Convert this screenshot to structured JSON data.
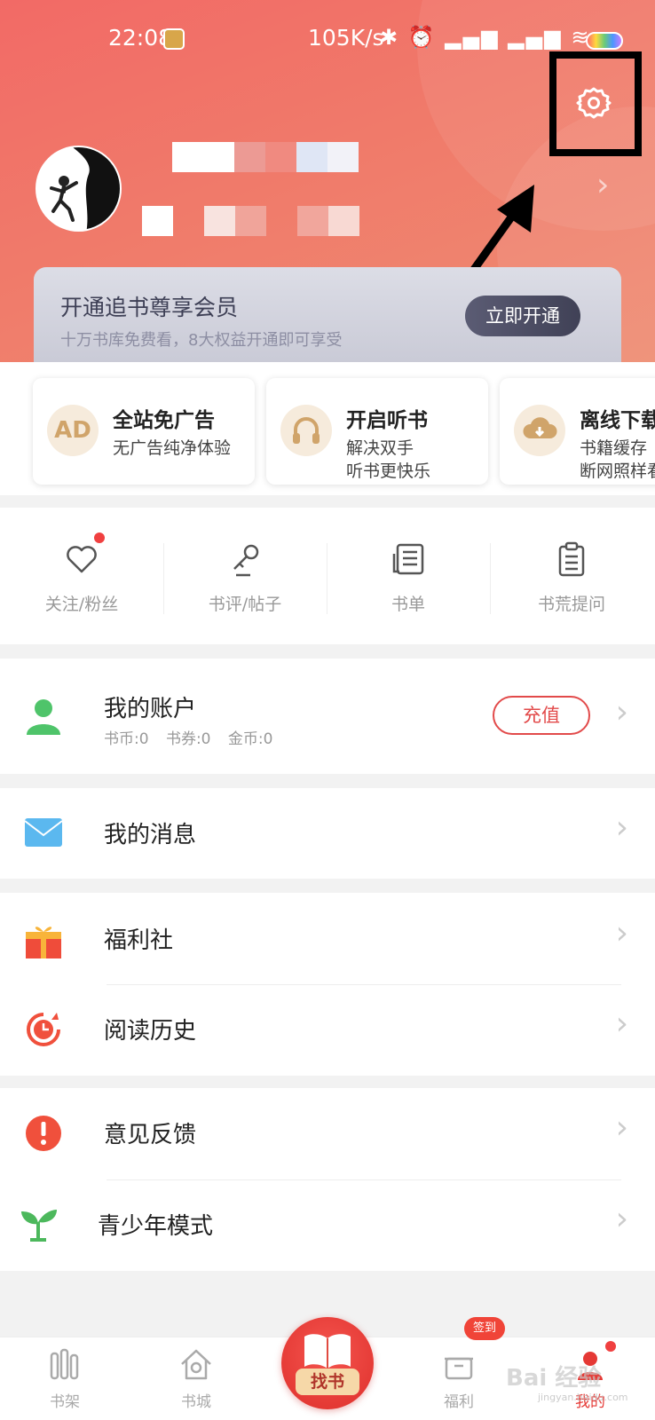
{
  "status_bar": {
    "time": "22:08",
    "network_speed": "105K/s",
    "icons": [
      "bluetooth-icon",
      "alarm-icon",
      "signal-hd-icon",
      "signal-hd-icon",
      "wifi-icon",
      "wifi-icon",
      "battery-icon"
    ]
  },
  "header": {
    "settings_icon": "gear-icon",
    "avatar": "climber-avatar"
  },
  "vip": {
    "title": "开通追书尊享会员",
    "subtitle": "十万书库免费看，8大权益开通即可享受",
    "button": "立即开通"
  },
  "features": [
    {
      "icon": "ad-free-icon",
      "badge": "AD",
      "title": "全站免广告",
      "subtitle": "无广告纯净体验"
    },
    {
      "icon": "headphones-icon",
      "title": "开启听书",
      "subtitle_lines": [
        "解决双手",
        "听书更快乐"
      ]
    },
    {
      "icon": "cloud-download-icon",
      "title": "离线下载",
      "subtitle_lines": [
        "书籍缓存",
        "断网照样看"
      ]
    }
  ],
  "quick_actions": [
    {
      "icon": "heart-icon",
      "label": "关注/粉丝",
      "dot": true
    },
    {
      "icon": "microphone-icon",
      "label": "书评/帖子"
    },
    {
      "icon": "book-list-icon",
      "label": "书单"
    },
    {
      "icon": "clipboard-icon",
      "label": "书荒提问"
    }
  ],
  "account": {
    "title": "我的账户",
    "balance": "书币:0 书券:0 金币:0",
    "recharge": "充值"
  },
  "menu": {
    "messages": "我的消息",
    "welfare": "福利社",
    "history": "阅读历史",
    "feedback": "意见反馈",
    "youth": "青少年模式"
  },
  "bottom_nav": {
    "bookshelf": "书架",
    "bookstore": "书城",
    "find_book": "找书",
    "welfare": "福利",
    "sign_badge": "签到",
    "mine": "我的",
    "active": "mine"
  },
  "watermark": {
    "text": "Bai 经验",
    "sub": "jingyan.baidu.com"
  },
  "colors": {
    "accent": "#f26a66",
    "red": "#e24a4a",
    "gold": "#d0a46a",
    "vip_btn": "#404156"
  }
}
